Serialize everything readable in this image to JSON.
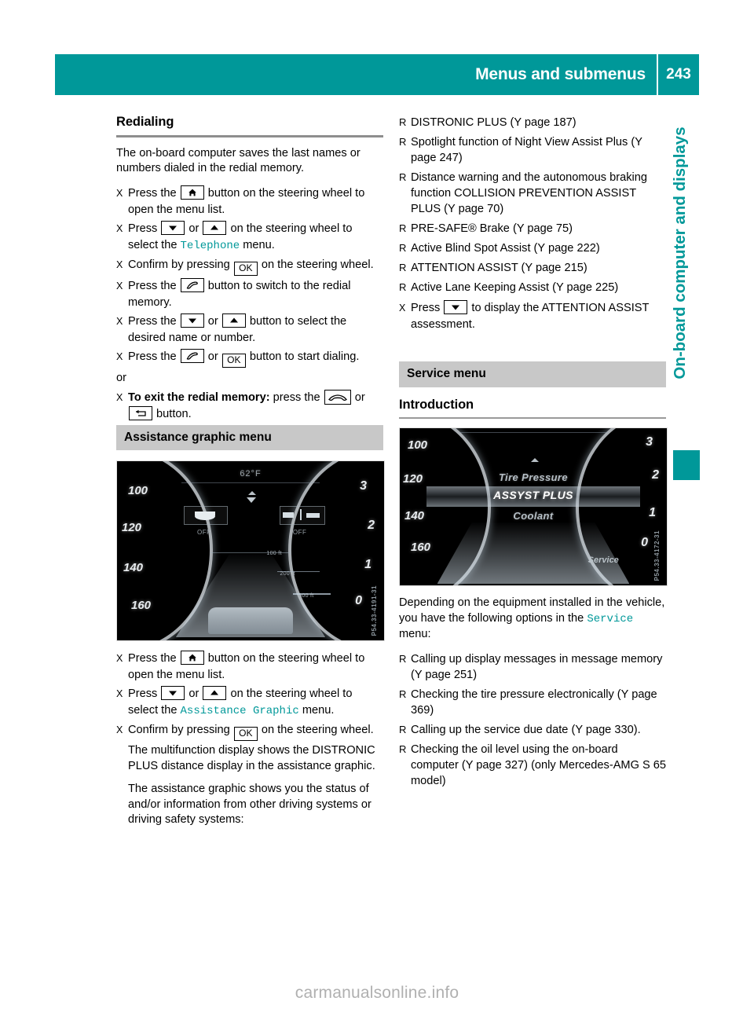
{
  "header": {
    "title": "Menus and submenus",
    "page_number": "243"
  },
  "side_tab": {
    "label": "On-board computer and displays"
  },
  "left_column": {
    "heading": "Redialing",
    "intro": "The on-board computer saves the last names or numbers dialed in the redial memory.",
    "steps": [
      {
        "marker": "X",
        "pre": "Press the ",
        "key1": "home-icon",
        "mid": " button on the steering wheel to open the menu list.",
        "post": ""
      },
      {
        "marker": "X",
        "pre": "Press ",
        "key1": "down-arrow",
        "mid": " or ",
        "key2": "up-arrow",
        "post": " on the steering wheel to select the ",
        "menu": "Telephone",
        "tail": " menu."
      },
      {
        "marker": "X",
        "pre": "Confirm by pressing ",
        "key1": "OK",
        "post": " on the steering wheel."
      },
      {
        "marker": "X",
        "pre": "Press the ",
        "key1": "phone-receiver-icon",
        "post": " button to switch to the redial memory."
      },
      {
        "marker": "X",
        "pre": "Press the ",
        "key1": "down-arrow",
        "mid": " or ",
        "key2": "up-arrow",
        "post": " button to select the desired name or number."
      },
      {
        "marker": "X",
        "pre": "Press the ",
        "key1": "phone-receiver-icon",
        "mid": " or ",
        "key2": "OK",
        "post": " button to start dialing."
      }
    ],
    "or_label": "or",
    "exit_step": {
      "marker": "X",
      "bold": "To exit the redial memory:",
      "pre": " press the ",
      "key1": "phone-hangup-icon",
      "mid": " or ",
      "key2": "back-arrow-icon",
      "post": " button."
    },
    "section_title": "Assistance graphic menu",
    "steps2": [
      {
        "marker": "X",
        "pre": "Press the ",
        "key1": "home-icon",
        "post": " button on the steering wheel to open the menu list."
      },
      {
        "marker": "X",
        "pre": "Press ",
        "key1": "down-arrow",
        "mid": " or ",
        "key2": "up-arrow",
        "post": " on the steering wheel to select the ",
        "menu": "Assistance Graphic",
        "tail": " menu."
      },
      {
        "marker": "X",
        "pre": "Confirm by pressing ",
        "key1": "OK",
        "post": " on the steering wheel."
      }
    ],
    "note1": "The multifunction display shows the DISTRONIC PLUS distance display in the assistance graphic.",
    "note2": "The assistance graphic shows you the status of and/or information from other driving systems or driving safety systems:"
  },
  "right_column": {
    "bullets": [
      {
        "marker": "R",
        "text": "DISTRONIC PLUS (",
        "ref": "Y page 187",
        "tail": ")"
      },
      {
        "marker": "R",
        "text": "Spotlight function of Night View Assist Plus (",
        "ref": "Y page 247",
        "tail": ")"
      },
      {
        "marker": "R",
        "text": "Distance warning and the autonomous braking function COLLISION PREVENTION ASSIST PLUS (",
        "ref": "Y page 70",
        "tail": ")"
      },
      {
        "marker": "R",
        "text": "PRE-SAFE® Brake (",
        "ref": "Y page 75",
        "tail": ")"
      },
      {
        "marker": "R",
        "text": "Active Blind Spot Assist (",
        "ref": "Y page 222",
        "tail": ")"
      },
      {
        "marker": "R",
        "text": "ATTENTION ASSIST (",
        "ref": "Y page 215",
        "tail": ")"
      },
      {
        "marker": "R",
        "text": "Active Lane Keeping Assist (",
        "ref": "Y page 225",
        "tail": ")"
      }
    ],
    "press_step": {
      "marker": "X",
      "pre": "Press ",
      "key1": "down-arrow",
      "post": " to display the ATTENTION ASSIST assessment."
    },
    "section_title": "Service menu",
    "subheading": "Introduction",
    "intro_pre": "Depending on the equipment installed in the vehicle, you have the following options in the ",
    "intro_menu": "Service",
    "intro_post": " menu:",
    "options": [
      {
        "marker": "R",
        "text": "Calling up display messages in message memory (",
        "ref": "Y page 251",
        "tail": ")"
      },
      {
        "marker": "R",
        "text": "Checking the tire pressure electronically (",
        "ref": "Y page 369",
        "tail": ")"
      },
      {
        "marker": "R",
        "text": "Calling up the service due date (",
        "ref": "Y page 330",
        "tail": ")."
      },
      {
        "marker": "R",
        "text": "Checking the oil level using the on-board computer (",
        "ref": "Y page 327",
        "tail": ") (only Mercedes-AMG S 65 model)"
      }
    ]
  },
  "figures": {
    "assistance_graphic": {
      "name": "instrument-cluster-assistance-graphic",
      "temperature": "62°F",
      "speed_ticks": [
        "100",
        "120",
        "140",
        "160"
      ],
      "rpm_ticks": [
        "3",
        "2",
        "1",
        "0"
      ],
      "icon_labels": [
        "OFF",
        "OFF"
      ],
      "distance_labels": [
        "100 ft",
        "200 ft",
        "300 ft"
      ],
      "credit": "P54.33-4191-31"
    },
    "service_menu": {
      "name": "instrument-cluster-service-menu",
      "speed_ticks": [
        "100",
        "120",
        "140",
        "160"
      ],
      "rpm_ticks": [
        "3",
        "2",
        "1",
        "0"
      ],
      "menu_items": [
        "Tire Pressure",
        "ASSYST PLUS",
        "Coolant"
      ],
      "selected_item": "ASSYST PLUS",
      "footer_label": "Service",
      "credit": "P54.33-4172-31"
    }
  },
  "watermark": "carmanualsonline.info",
  "colors": {
    "teal": "#009899",
    "section_gray": "#c8c8c8",
    "rule_gray": "#8e8e8e"
  }
}
